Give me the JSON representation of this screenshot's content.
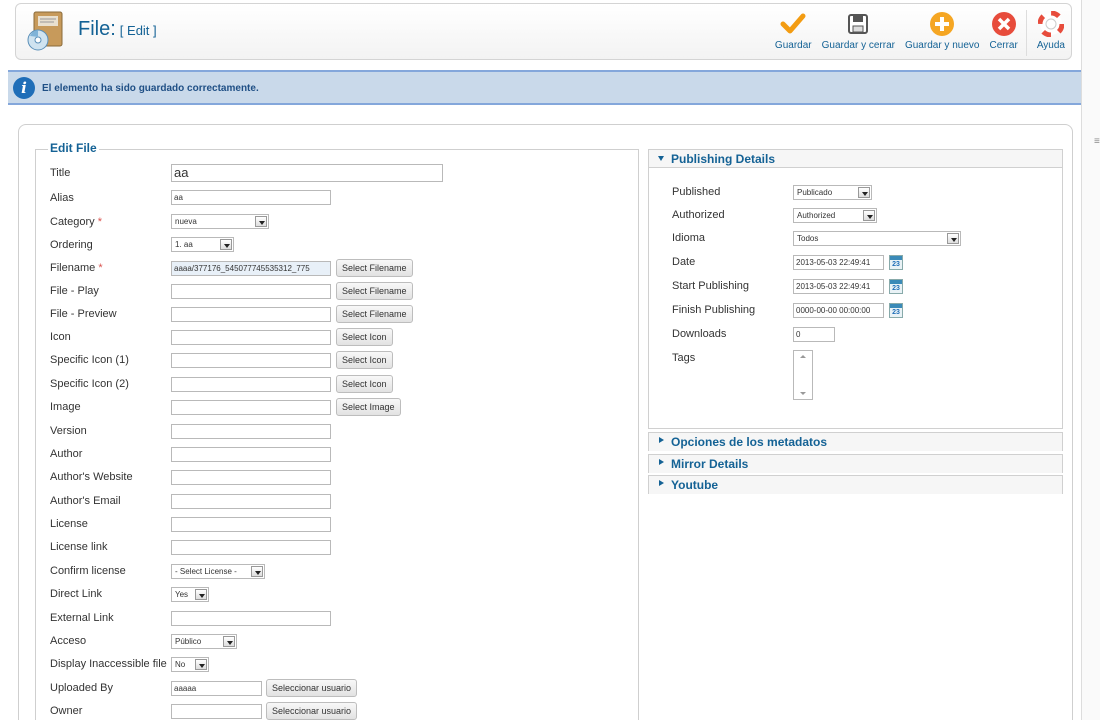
{
  "header": {
    "title": "File:",
    "subtitle": "[ Edit ]",
    "toolbar": [
      {
        "label": "Guardar",
        "icon": "check-icon",
        "color": "#f39c12"
      },
      {
        "label": "Guardar y cerrar",
        "icon": "save-icon",
        "color": "#555555"
      },
      {
        "label": "Guardar y nuevo",
        "icon": "plus-icon",
        "color": "#f5a623"
      },
      {
        "label": "Cerrar",
        "icon": "close-icon",
        "color": "#e74c3c"
      },
      {
        "label": "Ayuda",
        "icon": "lifebuoy-icon",
        "color": "#e74c3c"
      }
    ]
  },
  "message": {
    "text": "El elemento ha sido guardado correctamente."
  },
  "edit": {
    "legend": "Edit File",
    "fields": {
      "title": {
        "label": "Title",
        "value": "aa"
      },
      "alias": {
        "label": "Alias",
        "value": "aa"
      },
      "category": {
        "label": "Category",
        "value": "nueva"
      },
      "ordering": {
        "label": "Ordering",
        "value": "1. aa"
      },
      "filename": {
        "label": "Filename",
        "value": "aaaa/377176_545077745535312_775",
        "button": "Select Filename"
      },
      "file_play": {
        "label": "File - Play",
        "value": "",
        "button": "Select Filename"
      },
      "file_preview": {
        "label": "File - Preview",
        "value": "",
        "button": "Select Filename"
      },
      "icon": {
        "label": "Icon",
        "value": "",
        "button": "Select Icon"
      },
      "specific_icon_1": {
        "label": "Specific Icon (1)",
        "value": "",
        "button": "Select Icon"
      },
      "specific_icon_2": {
        "label": "Specific Icon (2)",
        "value": "",
        "button": "Select Icon"
      },
      "image": {
        "label": "Image",
        "value": "",
        "button": "Select Image"
      },
      "version": {
        "label": "Version",
        "value": ""
      },
      "author": {
        "label": "Author",
        "value": ""
      },
      "author_website": {
        "label": "Author's Website",
        "value": ""
      },
      "author_email": {
        "label": "Author's Email",
        "value": ""
      },
      "license": {
        "label": "License",
        "value": ""
      },
      "license_link": {
        "label": "License link",
        "value": ""
      },
      "confirm_license": {
        "label": "Confirm license",
        "value": "- Select License -"
      },
      "direct_link": {
        "label": "Direct Link",
        "value": "Yes"
      },
      "external_link": {
        "label": "External Link",
        "value": ""
      },
      "acceso": {
        "label": "Acceso",
        "value": "Público"
      },
      "display_inaccessible": {
        "label": "Display Inaccessible file",
        "value": "No"
      },
      "uploaded_by": {
        "label": "Uploaded By",
        "value": "aaaaa",
        "button": "Seleccionar usuario"
      },
      "owner": {
        "label": "Owner",
        "value": "",
        "button": "Seleccionar usuario"
      }
    },
    "required_mark": "*"
  },
  "publishing": {
    "title": "Publishing Details",
    "fields": {
      "published": {
        "label": "Published",
        "value": "Publicado"
      },
      "authorized": {
        "label": "Authorized",
        "value": "Authorized"
      },
      "idioma": {
        "label": "Idioma",
        "value": "Todos"
      },
      "date": {
        "label": "Date",
        "value": "2013-05-03 22:49:41"
      },
      "start_publishing": {
        "label": "Start Publishing",
        "value": "2013-05-03 22:49:41"
      },
      "finish_publishing": {
        "label": "Finish Publishing",
        "value": "0000-00-00 00:00:00"
      },
      "downloads": {
        "label": "Downloads",
        "value": "0"
      },
      "tags": {
        "label": "Tags"
      }
    },
    "calendar_day": "23"
  },
  "collapsed_panes": [
    {
      "title": "Opciones de los metadatos"
    },
    {
      "title": "Mirror Details"
    },
    {
      "title": "Youtube"
    }
  ]
}
